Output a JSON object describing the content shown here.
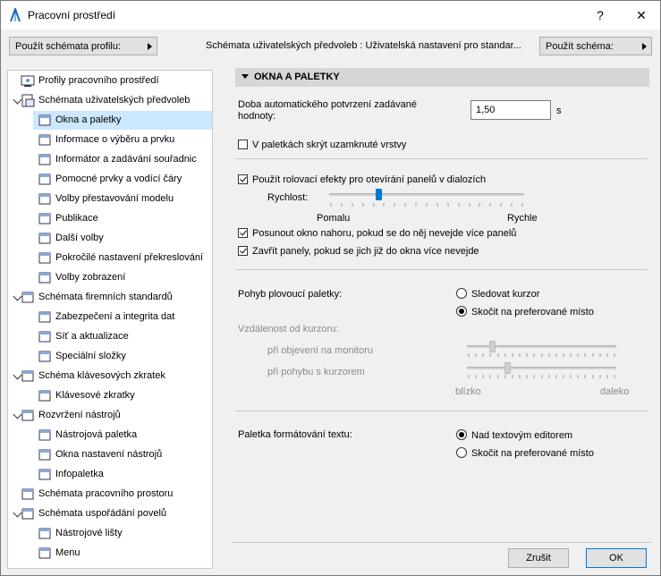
{
  "window": {
    "title": "Pracovní prostředí",
    "help": "?",
    "close": "✕"
  },
  "topbar": {
    "profile_button": "Použít schémata profilu:",
    "scheme_caption": "Schémata uživatelských předvoleb : Uživatelská nastavení pro standar...",
    "scheme_button": "Použít schéma:"
  },
  "tree": [
    {
      "label": "Profily pracovního prostředí",
      "icon": "profiles-icon"
    },
    {
      "label": "Schémata uživatelských předvoleb",
      "icon": "user-schemes-icon"
    },
    {
      "label": "Okna a paletky",
      "icon": "windows-palettes-icon"
    },
    {
      "label": "Informace o výběru a prvku",
      "icon": "selection-info-icon"
    },
    {
      "label": "Informátor a zadávání souřadnic",
      "icon": "xyz-coordinates-icon"
    },
    {
      "label": "Pomocné prvky a vodící čáry",
      "icon": "mouse-guides-icon"
    },
    {
      "label": "Volby přestavování modelu",
      "icon": "model-rebuild-icon"
    },
    {
      "label": "Publikace",
      "icon": "publishing-icon"
    },
    {
      "label": "Další volby",
      "icon": "more-options-icon"
    },
    {
      "label": "Pokročilé nastavení překreslování",
      "icon": "redraw-icon"
    },
    {
      "label": "Volby zobrazení",
      "icon": "display-options-icon"
    },
    {
      "label": "Schémata firemních standardů",
      "icon": "company-schemes-icon"
    },
    {
      "label": "Zabezpečení a integrita dat",
      "icon": "security-icon"
    },
    {
      "label": "Síť a aktualizace",
      "icon": "network-globe-icon"
    },
    {
      "label": "Speciální složky",
      "icon": "special-folders-icon"
    },
    {
      "label": "Schéma klávesových zkratek",
      "icon": "shortcut-schemes-icon"
    },
    {
      "label": "Klávesové zkratky",
      "icon": "keyboard-shortcuts-icon"
    },
    {
      "label": "Rozvržení nástrojů",
      "icon": "tool-layout-icon"
    },
    {
      "label": "Nástrojová paletka",
      "icon": "toolbox-icon"
    },
    {
      "label": "Okna nastavení nástrojů",
      "icon": "tool-settings-icon"
    },
    {
      "label": "Infopaletka",
      "icon": "info-box-icon"
    },
    {
      "label": "Schémata pracovního prostoru",
      "icon": "workspace-schemes-icon"
    },
    {
      "label": "Schémata uspořádání povelů",
      "icon": "command-layout-icon"
    },
    {
      "label": "Nástrojové lišty",
      "icon": "toolbars-icon"
    },
    {
      "label": "Menu",
      "icon": "menu-icon"
    }
  ],
  "panel": {
    "section_title": "OKNA A PALETKY",
    "autoconfirm_label": "Doba automatického potvrzení zadávané hodnoty:",
    "autoconfirm_value": "1,50",
    "autoconfirm_unit": "s",
    "hide_locked_layers": "V paletkách skrýt uzamknuté vrstvy",
    "hide_locked_checked": false,
    "scroll_effects": "Použít rolovací efekty pro otevírání panelů v dialozích",
    "scroll_effects_checked": true,
    "speed_label": "Rychlost:",
    "speed_slow": "Pomalu",
    "speed_fast": "Rychle",
    "speed_value": 0.25,
    "scroll_up": "Posunout okno nahoru, pokud se do něj nevejde více panelů",
    "scroll_up_checked": true,
    "close_panels": "Zavřít panely, pokud se jich již do okna více nevejde",
    "close_panels_checked": true,
    "floating_label": "Pohyb plovoucí paletky:",
    "floating_opt1": "Sledovat kurzor",
    "floating_opt2": "Skočit na preferované místo",
    "floating_selected": 2,
    "distance_label": "Vzdálenost od kurzoru:",
    "on_appear": "při objevení na monitoru",
    "on_move": "při pohybu s kurzorem",
    "on_appear_value": 0.17,
    "on_move_value": 0.27,
    "near": "blízko",
    "far": "daleko",
    "text_palette_label": "Paletka formátování textu:",
    "text_opt1": "Nad textovým editorem",
    "text_opt2": "Skočit na preferované místo",
    "text_selected": 1
  },
  "footer": {
    "cancel": "Zrušit",
    "ok": "OK"
  },
  "colors": {
    "accent": "#0078d7",
    "selection": "#cce8ff",
    "header": "#d6d6d6"
  }
}
